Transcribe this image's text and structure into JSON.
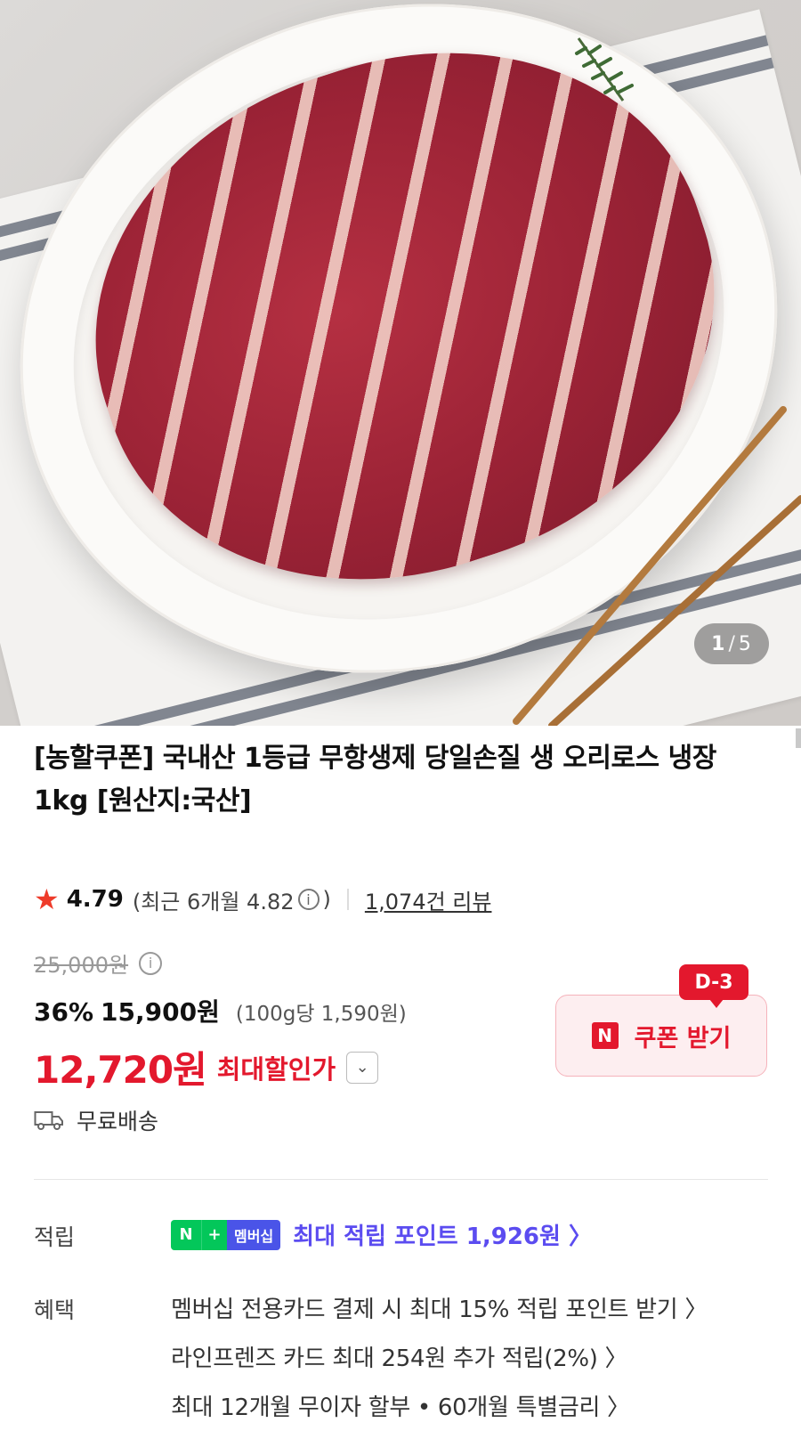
{
  "gallery": {
    "current": "1",
    "separator": "/",
    "total": "5"
  },
  "product": {
    "title": "[농할쿠폰] 국내산 1등급 무항생제 당일손질 생 오리로스 냉장 1kg [원산지:국산]"
  },
  "rating": {
    "star": "★",
    "score": "4.79",
    "recent_open": "(최근 6개월 4.82",
    "info_glyph": "i",
    "recent_close": ")",
    "reviews": "1,074건 리뷰"
  },
  "price": {
    "original": "25,000원",
    "discount_rate": "36%",
    "sale": "15,900원",
    "unit_price": "(100g당 1,590원)",
    "max_discount_price": "12,720원",
    "max_discount_label": "최대할인가",
    "chevron": "⌄"
  },
  "coupon": {
    "dday": "D-3",
    "n_logo": "N",
    "label": "쿠폰 받기"
  },
  "shipping": {
    "label": "무료배송"
  },
  "points": {
    "label": "적립",
    "badge_n": "N",
    "badge_plus": "+",
    "badge_membership": "멤버십",
    "text": "최대 적립 포인트 1,926원 〉"
  },
  "benefits": {
    "label": "혜택",
    "items": [
      "멤버십 전용카드 결제 시 최대 15% 적립 포인트 받기 〉",
      "라인프렌즈 카드 최대 254원 추가 적립(2%) 〉",
      "최대 12개월 무이자 할부 • 60개월 특별금리 〉"
    ]
  },
  "colors": {
    "accent_red": "#e3182d",
    "naver_green": "#03c75a",
    "membership_purple": "#5b4cf0"
  }
}
